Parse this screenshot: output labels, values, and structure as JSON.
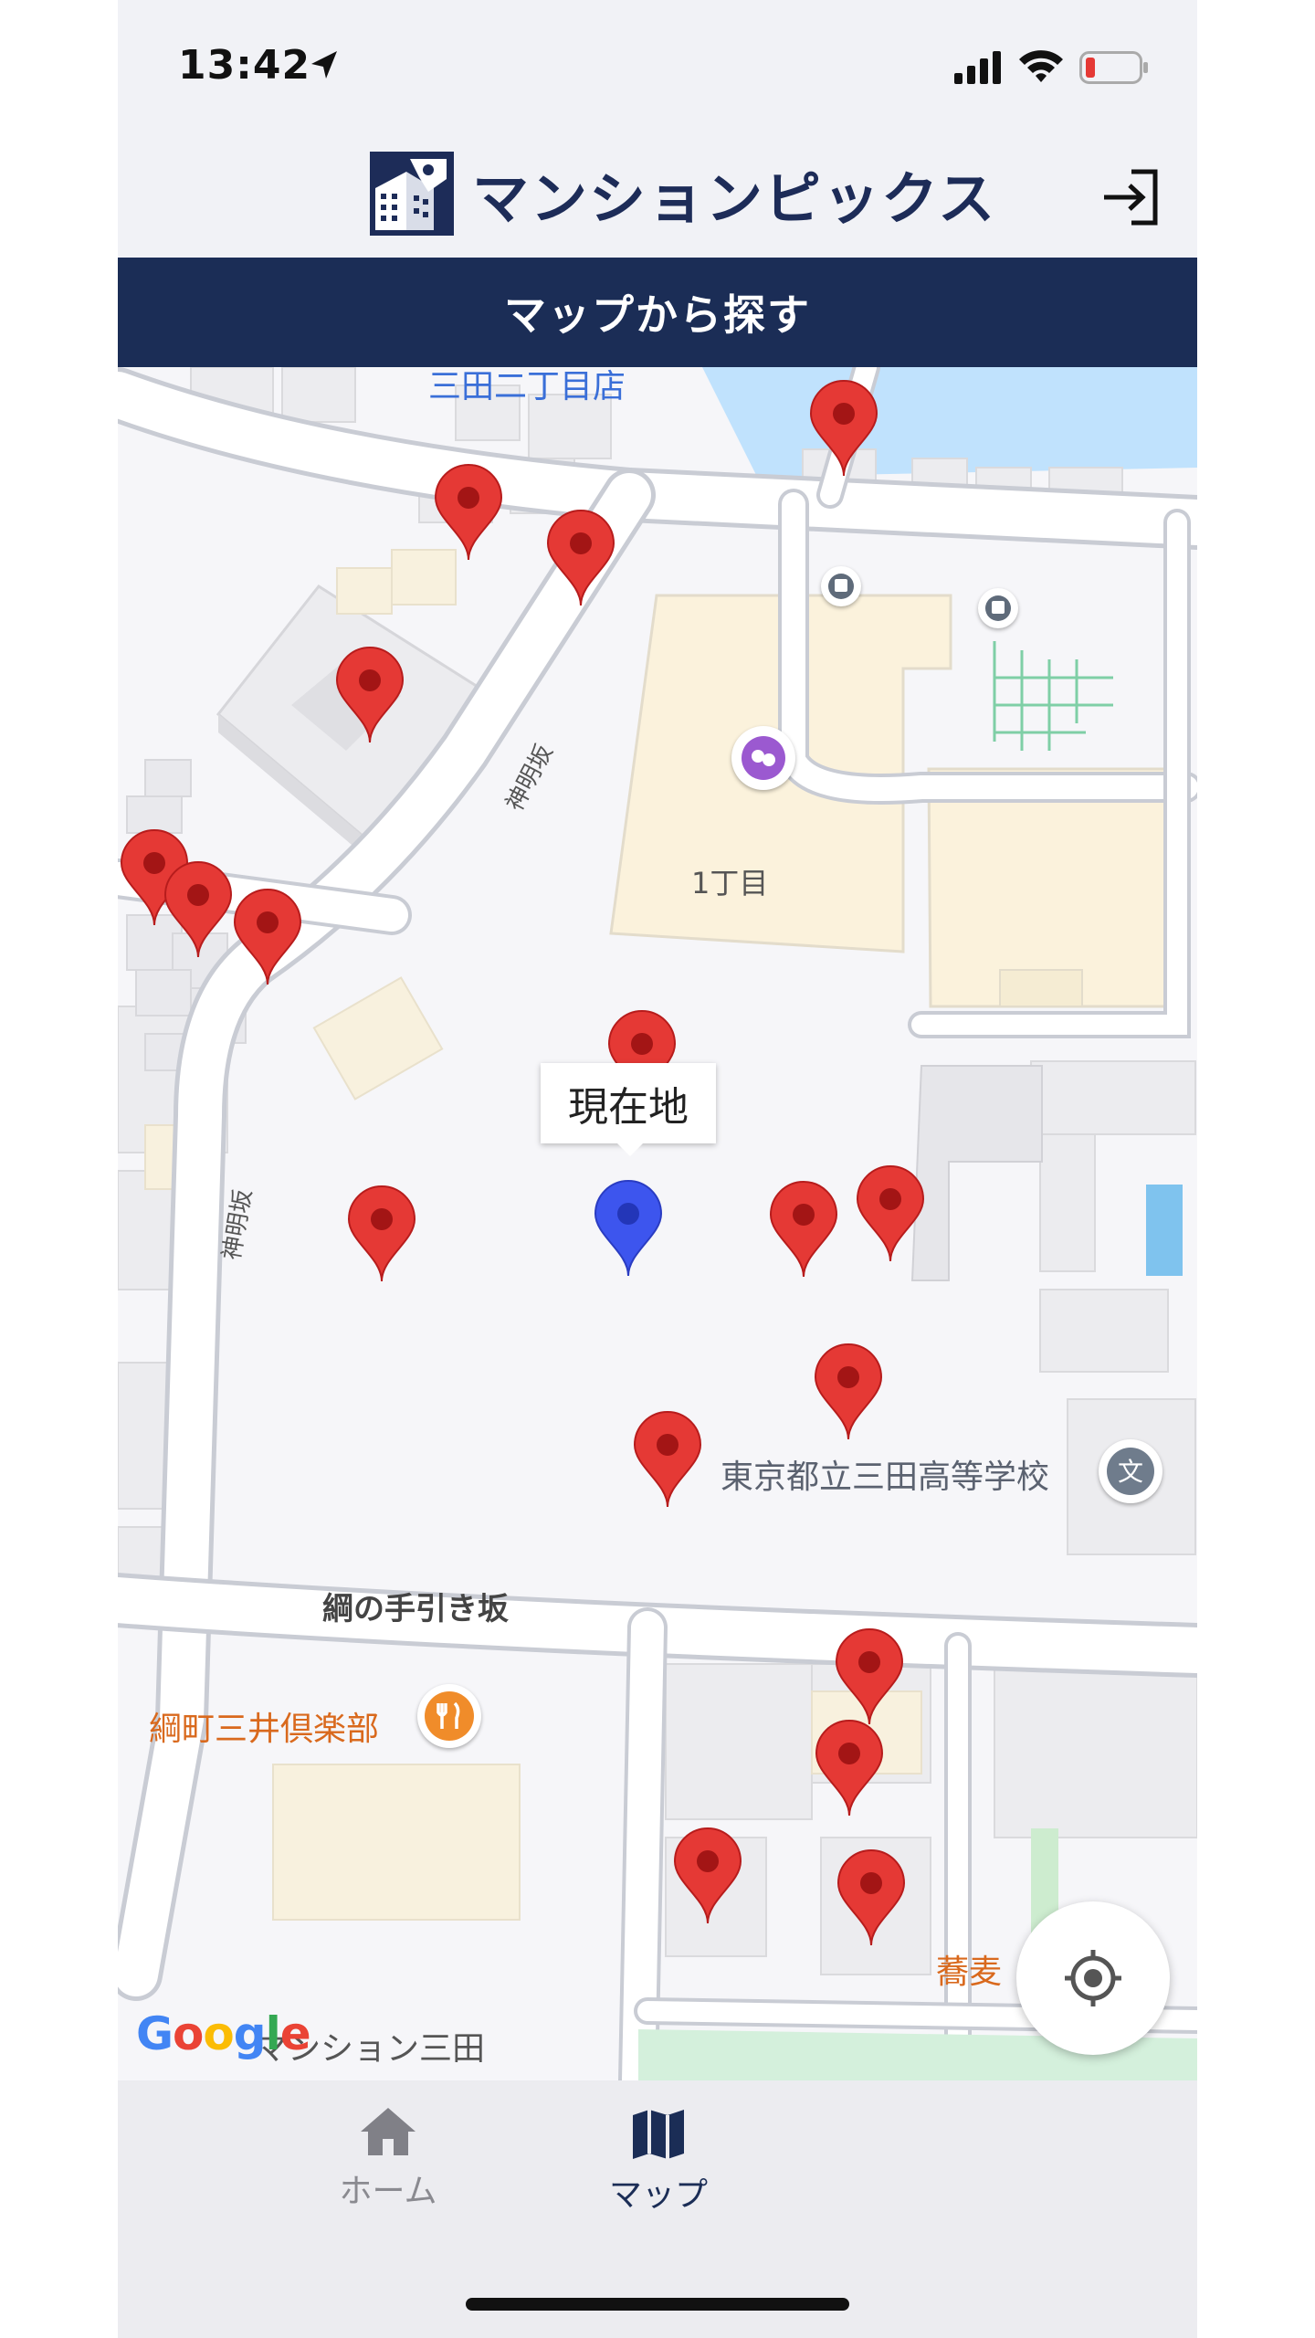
{
  "status_bar": {
    "time": "13:42"
  },
  "header": {
    "logo_text": "マンションピックス",
    "logo_icon": "building-logo-icon",
    "login_icon": "login-icon"
  },
  "title_bar": {
    "title": "マップから探す"
  },
  "map": {
    "labels": {
      "store_top": "三田二丁目店",
      "district": "1丁目",
      "street_kamiyazaka_1": "神明坂",
      "street_kamiyazaka_2": "神明坂",
      "school": "東京都立三田高等学校",
      "street_tsuna": "綱の手引き坂",
      "club": "綱町三井倶楽部",
      "soba": "蕎麦",
      "mansion": "マンション三田",
      "google": "Google"
    },
    "current_location_label": "現在地",
    "colors": {
      "pin_red": "#e53935",
      "pin_blue": "#3d55ee",
      "navy": "#1b2d56"
    }
  },
  "tab_bar": {
    "items": [
      {
        "label": "ホーム",
        "icon": "home-icon",
        "active": false
      },
      {
        "label": "マップ",
        "icon": "map-icon",
        "active": true
      }
    ]
  }
}
